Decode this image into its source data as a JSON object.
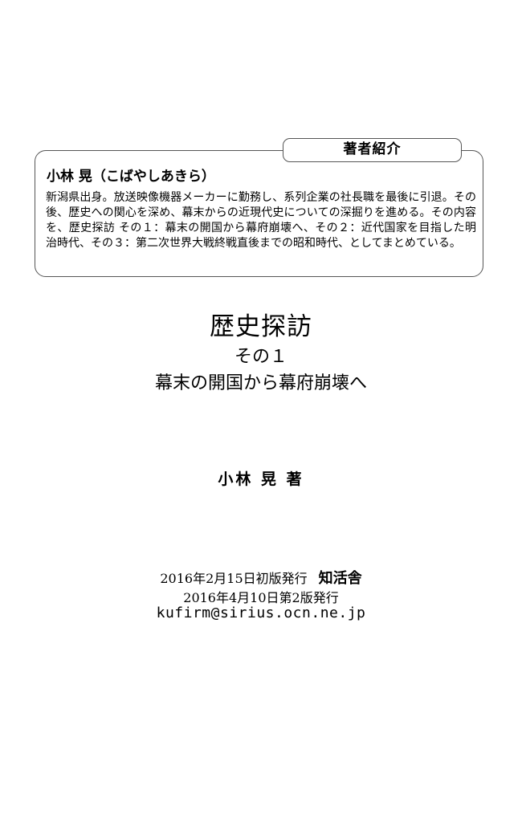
{
  "author_profile": {
    "tab_label": "著者紹介",
    "name": "小林 晃（こばやしあきら）",
    "bio": "新潟県出身。放送映像機器メーカーに勤務し、系列企業の社長職を最後に引退。その後、歴史への関心を深め、幕末からの近現代史についての深掘りを進める。その内容を、歴史探訪 その１：幕末の開国から幕府崩壊へ、その２：近代国家を目指した明治時代、その３：第二次世界大戦終戦直後までの昭和時代、としてまとめている。"
  },
  "book": {
    "title": "歴史探訪",
    "volume": "その１",
    "subtitle": "幕末の開国から幕府崩壊へ",
    "author_credit": "小林 晃 著"
  },
  "publication": {
    "first_edition": "2016年2月15日初版発行",
    "publisher": "知活舎",
    "second_edition": "2016年4月10日第2版発行",
    "email": "kufirm@sirius.ocn.ne.jp"
  }
}
